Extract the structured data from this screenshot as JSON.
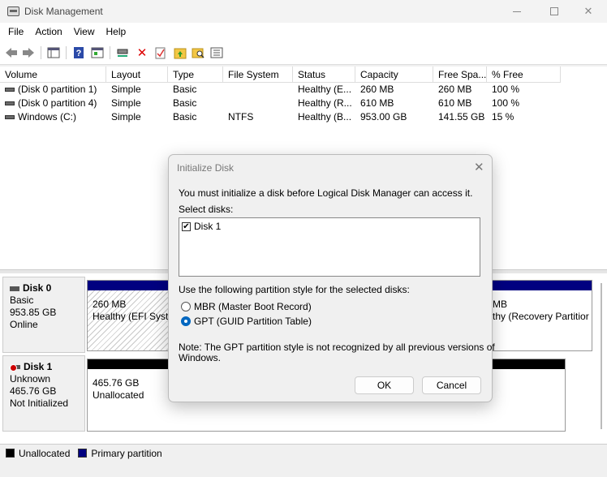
{
  "window": {
    "title": "Disk Management"
  },
  "menu": [
    "File",
    "Action",
    "View",
    "Help"
  ],
  "toolbar": {
    "icons": [
      "back-arrow-icon",
      "forward-arrow-icon",
      "console-tree-icon",
      "help-icon",
      "properties-icon",
      "connect-icon",
      "delete-icon",
      "check-icon",
      "folder-up-icon",
      "search-folder-icon",
      "list-icon"
    ]
  },
  "volume_list": {
    "columns": [
      "Volume",
      "Layout",
      "Type",
      "File System",
      "Status",
      "Capacity",
      "Free Spa...",
      "% Free"
    ],
    "rows": [
      {
        "volume": "(Disk 0 partition 1)",
        "layout": "Simple",
        "type": "Basic",
        "fs": "",
        "status": "Healthy (E...",
        "capacity": "260 MB",
        "free": "260 MB",
        "pct": "100 %"
      },
      {
        "volume": "(Disk 0 partition 4)",
        "layout": "Simple",
        "type": "Basic",
        "fs": "",
        "status": "Healthy (R...",
        "capacity": "610 MB",
        "free": "610 MB",
        "pct": "100 %"
      },
      {
        "volume": "Windows (C:)",
        "layout": "Simple",
        "type": "Basic",
        "fs": "NTFS",
        "status": "Healthy (B...",
        "capacity": "953.00 GB",
        "free": "141.55 GB",
        "pct": "15 %"
      }
    ]
  },
  "disks": [
    {
      "name": "Disk 0",
      "type": "Basic",
      "size": "953.85 GB",
      "state": "Online",
      "partitions": [
        {
          "size": "260 MB",
          "desc": "Healthy (EFI Syste"
        },
        {
          "size": "MB",
          "desc": "thy (Recovery Partitior"
        }
      ]
    },
    {
      "name": "Disk 1",
      "type": "Unknown",
      "size": "465.76 GB",
      "state": "Not Initialized",
      "partitions": [
        {
          "size": "465.76 GB",
          "desc": "Unallocated"
        }
      ]
    }
  ],
  "legend": [
    {
      "label": "Unallocated",
      "color": "#000000"
    },
    {
      "label": "Primary partition",
      "color": "#000080"
    }
  ],
  "dialog": {
    "title": "Initialize Disk",
    "intro": "You must initialize a disk before Logical Disk Manager can access it.",
    "select_label": "Select disks:",
    "disks": [
      "Disk 1"
    ],
    "style_label": "Use the following partition style for the selected disks:",
    "options": [
      "MBR (Master Boot Record)",
      "GPT (GUID Partition Table)"
    ],
    "selected_option": "GPT (GUID Partition Table)",
    "note_line1": "Note: The GPT partition style is not recognized by all previous versions of",
    "note_line2": "Windows.",
    "ok": "OK",
    "cancel": "Cancel"
  },
  "colors": {
    "primary_partition": "#000080",
    "unallocated": "#000000",
    "accent": "#0067c0"
  }
}
